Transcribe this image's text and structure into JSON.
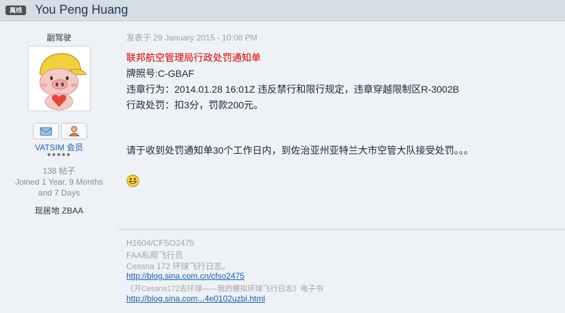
{
  "header": {
    "badge": "离线",
    "author_name": "You Peng Huang"
  },
  "profile": {
    "member_title": "副驾驶",
    "avatar_icon": "pig-with-yellow-cap-avatar",
    "buttons": [
      {
        "icon": "message-envelope-icon"
      },
      {
        "icon": "user-profile-icon"
      }
    ],
    "group": "VATSIM 会员",
    "rank_pips": "●●●●●",
    "post_count": "138 帖子",
    "joined_line1": "Joined 1 Year, 9 Months",
    "joined_line2": "and 7 Days",
    "location": "现居地 ZBAA"
  },
  "post": {
    "date": "发表于 29 January 2015 - 10:08 PM",
    "lines": [
      "联邦航空管理局行政处罚通知单",
      "牌照号:C-GBAF",
      "违章行为：2014.01.28 16:01Z 违反禁行和限行规定，违章穿越限制区R-3002B",
      "行政处罚：扣3分，罚款200元。",
      "请于收到处罚通知单30个工作日内，到佐治亚州亚特兰大市空管大队接受处罚。。。"
    ],
    "emoticon": "grin-smiley-icon"
  },
  "signature": {
    "line1": "H1604/CFSO2475",
    "line2": "FAA私照飞行员",
    "line3": "Cessna 172 环球飞行日志。",
    "link1": "http://blog.sina.com.cn/cfso2475",
    "line4": "《开Cessna172去环球——我的模拟环球飞行日志》电子书",
    "link2": "http://blog.sina.com...4e0102uzbi.html"
  },
  "colors": {
    "header_bg": "#d5dde5",
    "page_bg": "#eef1f6",
    "title_red": "#d40000",
    "link_blue": "#1b5ea8"
  }
}
